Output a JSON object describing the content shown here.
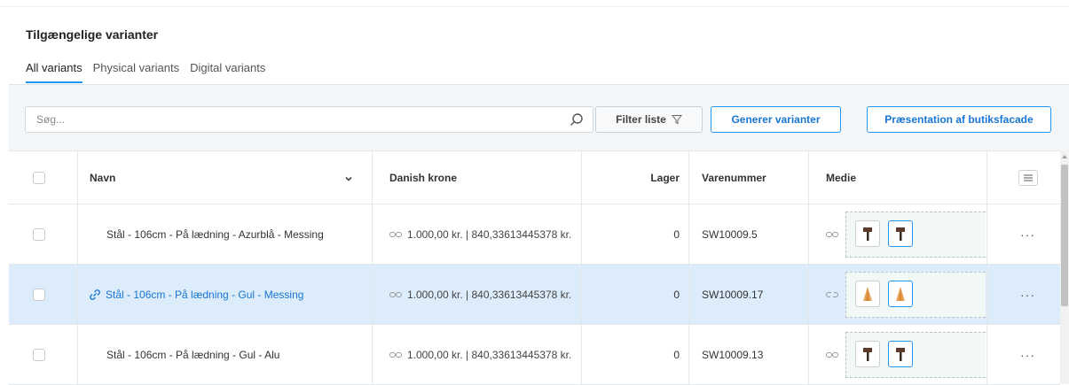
{
  "section": {
    "title": "Tilgængelige varianter"
  },
  "tabs": [
    {
      "label": "All variants",
      "active": true
    },
    {
      "label": "Physical variants",
      "active": false
    },
    {
      "label": "Digital variants",
      "active": false
    }
  ],
  "toolbar": {
    "search_placeholder": "Søg...",
    "filter_label": "Filter liste",
    "generate_label": "Generer varianter",
    "presentation_label": "Præsentation af butiksfacade"
  },
  "table": {
    "headers": {
      "name": "Navn",
      "price": "Danish krone",
      "stock": "Lager",
      "sku": "Varenummer",
      "media": "Medie"
    },
    "rows": [
      {
        "name": "Stål - 106cm - På lædning - Azurblå - Messing",
        "price": "1.000,00 kr. | 840,33613445378 kr.",
        "stock": "0",
        "sku": "SW10009.5",
        "selected": false,
        "menu": "···",
        "thumb": "tool"
      },
      {
        "name": "Stål - 106cm - På lædning - Gul - Messing",
        "price": "1.000,00 kr. | 840,33613445378 kr.",
        "stock": "0",
        "sku": "SW10009.17",
        "selected": true,
        "menu": "···",
        "thumb": "cone"
      },
      {
        "name": "Stål - 106cm - På lædning - Gul - Alu",
        "price": "1.000,00 kr. | 840,33613445378 kr.",
        "stock": "0",
        "sku": "SW10009.13",
        "selected": false,
        "menu": "···",
        "thumb": "tool"
      }
    ]
  },
  "colors": {
    "accent": "#2196f3",
    "selected_row": "#dcecfb",
    "toolbar_bg": "#f3f6f8"
  }
}
